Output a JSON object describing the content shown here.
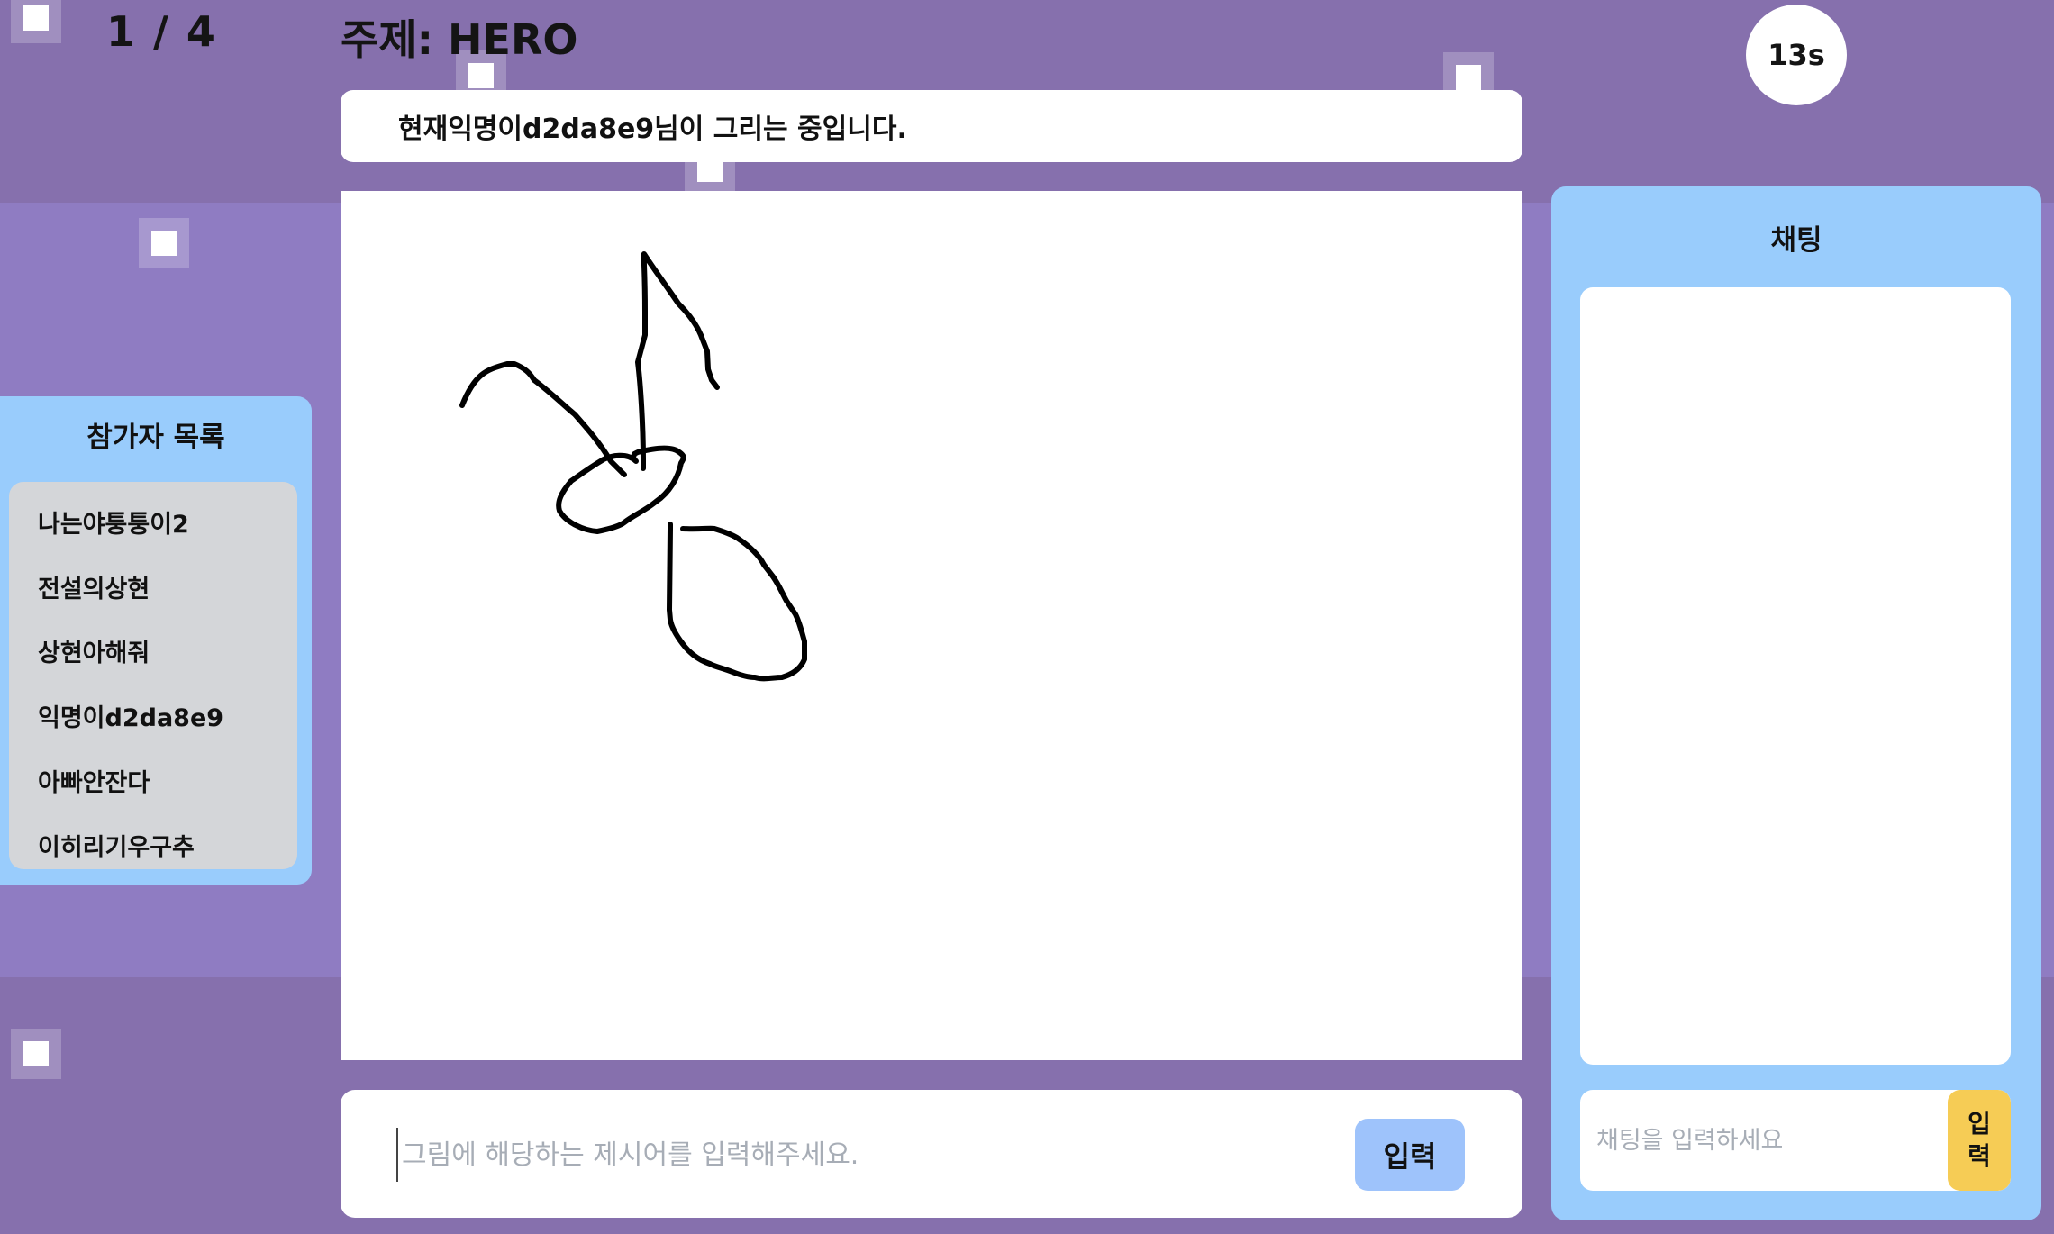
{
  "header": {
    "round": "1 / 4",
    "topic": "주제: HERO",
    "timer": "13s"
  },
  "status": {
    "message": "현재익명이d2da8e9님이 그리는 중입니다."
  },
  "canvas": {
    "stroke_color": "#000000"
  },
  "answer": {
    "placeholder": "그림에 해당하는 제시어를 입력해주세요.",
    "button_label": "입력"
  },
  "participants": {
    "title": "참가자 목록",
    "items": [
      "나는야퉁퉁이2",
      "전설의상현",
      "상현아해줘",
      "익명이d2da8e9",
      "아빠안잔다",
      "이히리기우구추"
    ]
  },
  "chat": {
    "title": "채팅",
    "placeholder": "채팅을 입력하세요",
    "send_label": "입\n력"
  },
  "colors": {
    "background": "#8670ad",
    "panel_blue": "#99ccfc",
    "answer_button": "#9ec3fb",
    "chat_send_button": "#f6cc55",
    "list_gray": "#d4d6d9"
  }
}
